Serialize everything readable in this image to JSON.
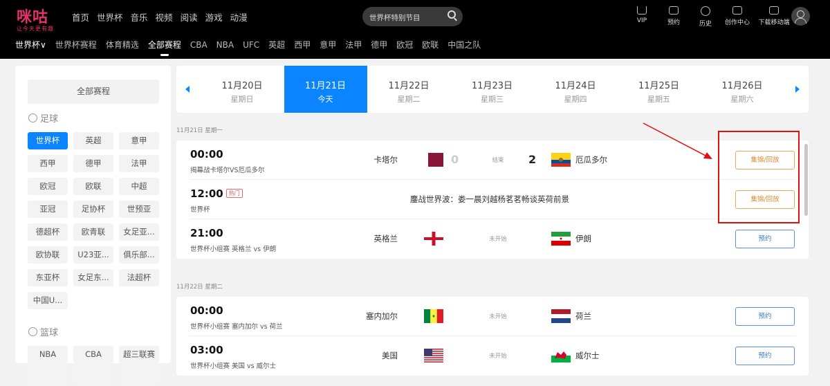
{
  "header": {
    "logo": "咪咕",
    "logo_slogan": "让今天更有趣",
    "nav": [
      "首页",
      "世界杯",
      "音乐",
      "视频",
      "阅读",
      "游戏",
      "动漫"
    ],
    "search_placeholder": "世界杯特别节目",
    "tools": [
      {
        "label": "VIP",
        "icon": "crown-icon"
      },
      {
        "label": "预约",
        "icon": "calendar-icon"
      },
      {
        "label": "历史",
        "icon": "clock-icon"
      },
      {
        "label": "创作中心",
        "icon": "play-box-icon"
      },
      {
        "label": "下载移动端",
        "icon": "phone-icon"
      }
    ]
  },
  "subnav": {
    "items": [
      "世界杯∨",
      "世界杯赛程",
      "体育精选",
      "全部赛程",
      "CBA",
      "NBA",
      "UFC",
      "英超",
      "西甲",
      "意甲",
      "法甲",
      "德甲",
      "欧冠",
      "欧联",
      "中国之队"
    ],
    "active": 3
  },
  "sidebar": {
    "all_label": "全部赛程",
    "categories": [
      {
        "name": "足球",
        "tags": [
          "世界杯",
          "英超",
          "意甲",
          "西甲",
          "德甲",
          "法甲",
          "欧冠",
          "欧联",
          "中超",
          "亚冠",
          "足协杯",
          "世预亚",
          "德超杯",
          "欧青联",
          "女足亚...",
          "欧协联",
          "U23亚...",
          "俱乐部...",
          "东亚杯",
          "女足东...",
          "法超杯",
          "中国U..."
        ],
        "active": 0
      },
      {
        "name": "篮球",
        "tags": [
          "NBA",
          "CBA",
          "超三联赛",
          "",
          "",
          ""
        ],
        "active": -1
      }
    ]
  },
  "dates": [
    {
      "d": "11月20日",
      "w": "星期日"
    },
    {
      "d": "11月21日",
      "w": "今天"
    },
    {
      "d": "11月22日",
      "w": "星期二"
    },
    {
      "d": "11月23日",
      "w": "星期三"
    },
    {
      "d": "11月24日",
      "w": "星期四"
    },
    {
      "d": "11月25日",
      "w": "星期五"
    },
    {
      "d": "11月26日",
      "w": "星期六"
    }
  ],
  "active_date": 1,
  "sections": [
    {
      "label": "11月21日 星期一",
      "matches": [
        {
          "time": "00:00",
          "desc": "揭幕战卡塔尔VS厄瓜多尔",
          "home": "卡塔尔",
          "home_flag": "qatar",
          "home_score": "0",
          "status": "结束",
          "away_score": "2",
          "away": "厄瓜多尔",
          "away_flag": "ecuador",
          "button": "集锦/回放"
        },
        {
          "time": "12:00",
          "hot": "热门",
          "desc": "世界杯",
          "title": "鏖战世界波：娄一晨刘越杨茗茗畅谈英荷前景",
          "button": "集锦/回放"
        },
        {
          "time": "21:00",
          "desc": "世界杯小组赛 英格兰 vs 伊朗",
          "home": "英格兰",
          "home_flag": "england",
          "status": "未开始",
          "away": "伊朗",
          "away_flag": "iran",
          "button": "预约"
        }
      ]
    },
    {
      "label": "11月22日 星期二",
      "matches": [
        {
          "time": "00:00",
          "desc": "世界杯小组赛 塞内加尔 vs 荷兰",
          "home": "塞内加尔",
          "home_flag": "senegal",
          "status": "未开始",
          "away": "荷兰",
          "away_flag": "netherlands",
          "button": "预约"
        },
        {
          "time": "03:00",
          "desc": "世界杯小组赛 美国 vs 威尔士",
          "home": "美国",
          "home_flag": "usa",
          "status": "未开始",
          "away": "威尔士",
          "away_flag": "wales",
          "button": "预约"
        }
      ]
    }
  ]
}
